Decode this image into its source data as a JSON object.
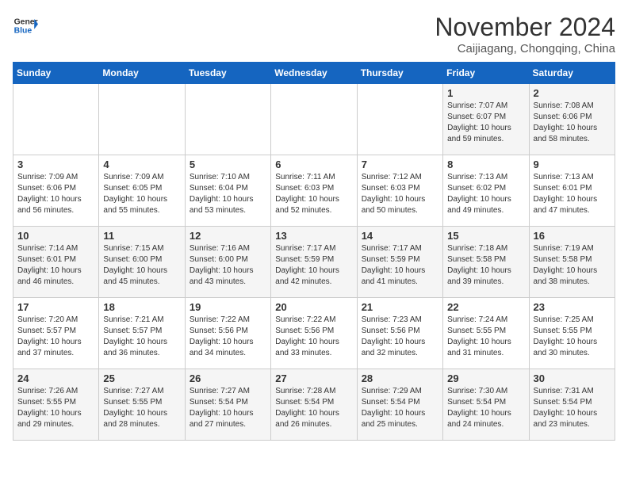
{
  "header": {
    "logo_line1": "General",
    "logo_line2": "Blue",
    "month": "November 2024",
    "location": "Caijiagang, Chongqing, China"
  },
  "days_of_week": [
    "Sunday",
    "Monday",
    "Tuesday",
    "Wednesday",
    "Thursday",
    "Friday",
    "Saturday"
  ],
  "weeks": [
    [
      {
        "day": "",
        "info": ""
      },
      {
        "day": "",
        "info": ""
      },
      {
        "day": "",
        "info": ""
      },
      {
        "day": "",
        "info": ""
      },
      {
        "day": "",
        "info": ""
      },
      {
        "day": "1",
        "info": "Sunrise: 7:07 AM\nSunset: 6:07 PM\nDaylight: 10 hours and 59 minutes."
      },
      {
        "day": "2",
        "info": "Sunrise: 7:08 AM\nSunset: 6:06 PM\nDaylight: 10 hours and 58 minutes."
      }
    ],
    [
      {
        "day": "3",
        "info": "Sunrise: 7:09 AM\nSunset: 6:06 PM\nDaylight: 10 hours and 56 minutes."
      },
      {
        "day": "4",
        "info": "Sunrise: 7:09 AM\nSunset: 6:05 PM\nDaylight: 10 hours and 55 minutes."
      },
      {
        "day": "5",
        "info": "Sunrise: 7:10 AM\nSunset: 6:04 PM\nDaylight: 10 hours and 53 minutes."
      },
      {
        "day": "6",
        "info": "Sunrise: 7:11 AM\nSunset: 6:03 PM\nDaylight: 10 hours and 52 minutes."
      },
      {
        "day": "7",
        "info": "Sunrise: 7:12 AM\nSunset: 6:03 PM\nDaylight: 10 hours and 50 minutes."
      },
      {
        "day": "8",
        "info": "Sunrise: 7:13 AM\nSunset: 6:02 PM\nDaylight: 10 hours and 49 minutes."
      },
      {
        "day": "9",
        "info": "Sunrise: 7:13 AM\nSunset: 6:01 PM\nDaylight: 10 hours and 47 minutes."
      }
    ],
    [
      {
        "day": "10",
        "info": "Sunrise: 7:14 AM\nSunset: 6:01 PM\nDaylight: 10 hours and 46 minutes."
      },
      {
        "day": "11",
        "info": "Sunrise: 7:15 AM\nSunset: 6:00 PM\nDaylight: 10 hours and 45 minutes."
      },
      {
        "day": "12",
        "info": "Sunrise: 7:16 AM\nSunset: 6:00 PM\nDaylight: 10 hours and 43 minutes."
      },
      {
        "day": "13",
        "info": "Sunrise: 7:17 AM\nSunset: 5:59 PM\nDaylight: 10 hours and 42 minutes."
      },
      {
        "day": "14",
        "info": "Sunrise: 7:17 AM\nSunset: 5:59 PM\nDaylight: 10 hours and 41 minutes."
      },
      {
        "day": "15",
        "info": "Sunrise: 7:18 AM\nSunset: 5:58 PM\nDaylight: 10 hours and 39 minutes."
      },
      {
        "day": "16",
        "info": "Sunrise: 7:19 AM\nSunset: 5:58 PM\nDaylight: 10 hours and 38 minutes."
      }
    ],
    [
      {
        "day": "17",
        "info": "Sunrise: 7:20 AM\nSunset: 5:57 PM\nDaylight: 10 hours and 37 minutes."
      },
      {
        "day": "18",
        "info": "Sunrise: 7:21 AM\nSunset: 5:57 PM\nDaylight: 10 hours and 36 minutes."
      },
      {
        "day": "19",
        "info": "Sunrise: 7:22 AM\nSunset: 5:56 PM\nDaylight: 10 hours and 34 minutes."
      },
      {
        "day": "20",
        "info": "Sunrise: 7:22 AM\nSunset: 5:56 PM\nDaylight: 10 hours and 33 minutes."
      },
      {
        "day": "21",
        "info": "Sunrise: 7:23 AM\nSunset: 5:56 PM\nDaylight: 10 hours and 32 minutes."
      },
      {
        "day": "22",
        "info": "Sunrise: 7:24 AM\nSunset: 5:55 PM\nDaylight: 10 hours and 31 minutes."
      },
      {
        "day": "23",
        "info": "Sunrise: 7:25 AM\nSunset: 5:55 PM\nDaylight: 10 hours and 30 minutes."
      }
    ],
    [
      {
        "day": "24",
        "info": "Sunrise: 7:26 AM\nSunset: 5:55 PM\nDaylight: 10 hours and 29 minutes."
      },
      {
        "day": "25",
        "info": "Sunrise: 7:27 AM\nSunset: 5:55 PM\nDaylight: 10 hours and 28 minutes."
      },
      {
        "day": "26",
        "info": "Sunrise: 7:27 AM\nSunset: 5:54 PM\nDaylight: 10 hours and 27 minutes."
      },
      {
        "day": "27",
        "info": "Sunrise: 7:28 AM\nSunset: 5:54 PM\nDaylight: 10 hours and 26 minutes."
      },
      {
        "day": "28",
        "info": "Sunrise: 7:29 AM\nSunset: 5:54 PM\nDaylight: 10 hours and 25 minutes."
      },
      {
        "day": "29",
        "info": "Sunrise: 7:30 AM\nSunset: 5:54 PM\nDaylight: 10 hours and 24 minutes."
      },
      {
        "day": "30",
        "info": "Sunrise: 7:31 AM\nSunset: 5:54 PM\nDaylight: 10 hours and 23 minutes."
      }
    ]
  ]
}
